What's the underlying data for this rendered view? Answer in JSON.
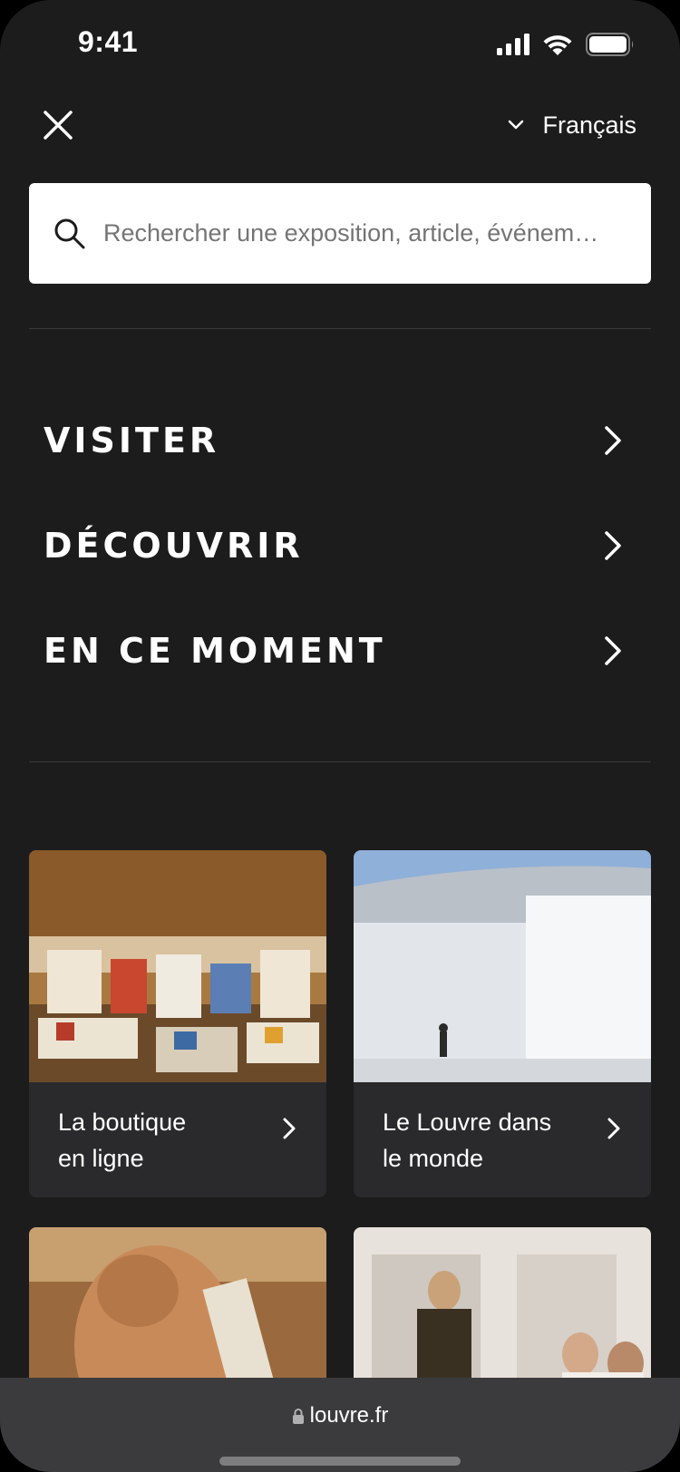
{
  "status_bar": {
    "time": "9:41"
  },
  "header": {
    "language": "Français"
  },
  "search": {
    "placeholder": "Rechercher une exposition, article, événem…"
  },
  "nav": {
    "items": [
      {
        "label": "VISITER"
      },
      {
        "label": "DÉCOUVRIR"
      },
      {
        "label": "EN CE MOMENT"
      }
    ]
  },
  "cards": [
    {
      "title": "La boutique\nen ligne"
    },
    {
      "title": "Le Louvre dans\nle monde"
    }
  ],
  "browser": {
    "url": "louvre.fr"
  },
  "icons": [
    "cellular-signal-icon",
    "wifi-icon",
    "battery-icon",
    "close-icon",
    "chevron-down-icon",
    "search-icon",
    "chevron-right-icon",
    "lock-icon"
  ]
}
